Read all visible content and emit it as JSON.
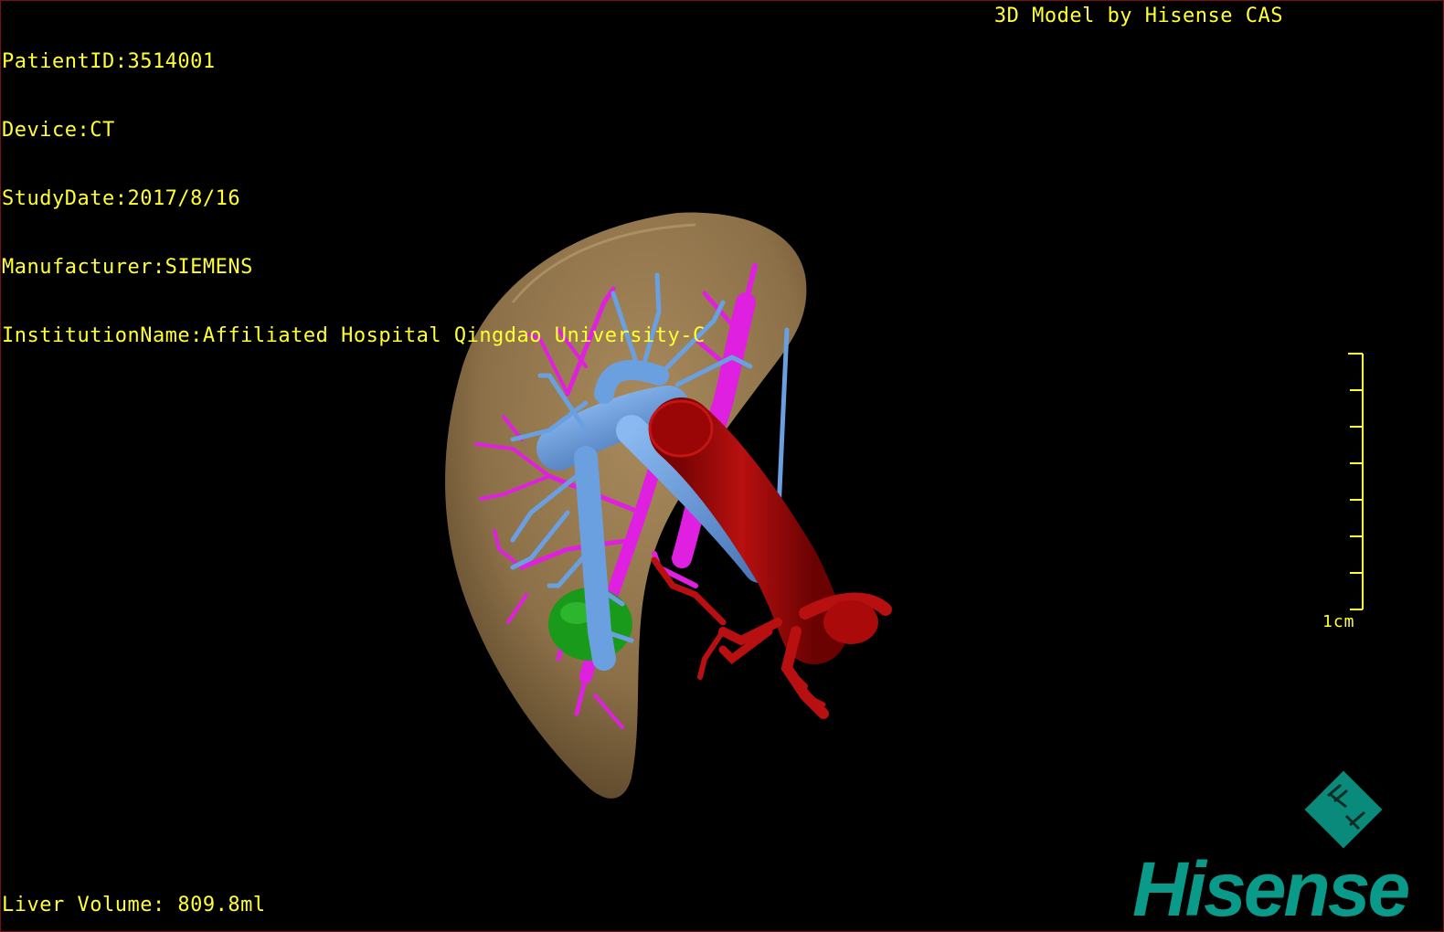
{
  "info": {
    "patient_id": "PatientID:3514001",
    "device": "Device:CT",
    "study_date": "StudyDate:2017/8/16",
    "manufacturer": "Manufacturer:SIEMENS",
    "institution": "InstitutionName:Affiliated Hospital Qingdao University-C"
  },
  "credit": "3D Model by Hisense CAS",
  "volume": "Liver Volume: 809.8ml",
  "scale": {
    "label": "1cm",
    "ticks": 8
  },
  "brand": {
    "name": "Hisense",
    "mark": "HT"
  },
  "colors": {
    "overlay_text": "#ffff33",
    "liver": "#8c7048",
    "portal_vein": "#6aa0e0",
    "hepatic_vein": "#e020e0",
    "artery_aorta": "#aa0a0a",
    "tumor": "#1a9a1a",
    "brand": "#0a9a8a"
  }
}
